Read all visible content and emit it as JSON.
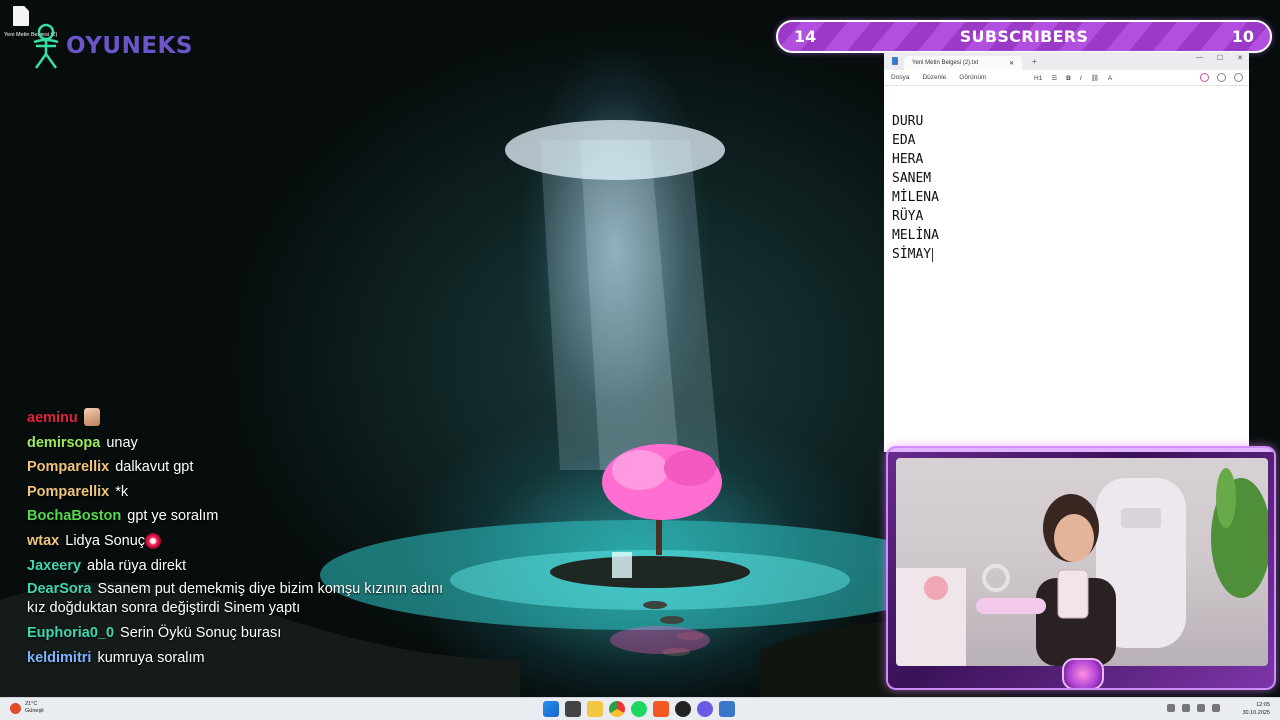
{
  "desktop": {
    "file_icon_label": "Yeni Metin Belgesi (2)",
    "logo_text": "OYUNEKS"
  },
  "subscribers_bar": {
    "left_count": "14",
    "title": "SUBSCRIBERS",
    "right_count": "10",
    "colors": {
      "stripe_a": "#b34fde",
      "stripe_b": "#9a3ac6"
    }
  },
  "notepad": {
    "tab_title": "Yeni Metin Belgesi (2).txt",
    "new_tab": "+",
    "menu": [
      "Dosya",
      "Düzenle",
      "Görünüm"
    ],
    "toolbar": {
      "heading": "H1",
      "bold": "B",
      "italic": "I"
    },
    "lines": [
      "DURU",
      "EDA",
      "HERA",
      "SANEM",
      "MİLENA",
      "RÜYA",
      "MELİNA",
      "SİMAY"
    ]
  },
  "chat": [
    {
      "user": "aeminu",
      "color": "#e0223d",
      "text": "",
      "emote": "face"
    },
    {
      "user": "demirsopa",
      "color": "#9dea5a",
      "text": "unay"
    },
    {
      "user": "Pomparellix",
      "color": "#f0c47c",
      "text": "dalkavut gpt"
    },
    {
      "user": "Pomparellix",
      "color": "#f0c47c",
      "text": "*k"
    },
    {
      "user": "BochaBoston",
      "color": "#55d84a",
      "text": "gpt ye soralım"
    },
    {
      "user": "wtax",
      "color": "#f0c47c",
      "text": "Lidya Sonuç",
      "emote": "burst"
    },
    {
      "user": "Jaxeery",
      "color": "#3fd6b0",
      "text": "abla rüya direkt"
    },
    {
      "user": "DearSora",
      "color": "#3fd6b0",
      "text": "Ssanem put demekmiş diye bizim komşu kızının adını kız doğduktan sonra değiştirdi Sinem yaptı",
      "multi": true
    },
    {
      "user": "Euphoria0_0",
      "color": "#3fd6b0",
      "text": "Serin Öykü Sonuç burası"
    },
    {
      "user": "keldimitri",
      "color": "#7fb2ff",
      "text": "kumruya soralım"
    }
  ],
  "taskbar": {
    "weather_temp": "21°C",
    "weather_desc": "Güneşli",
    "time": "12:05",
    "date": "30.10.2025",
    "apps": [
      "windows-start",
      "file-explorer",
      "folder",
      "chrome",
      "spotify",
      "brave",
      "obs",
      "discord",
      "notepad"
    ]
  }
}
